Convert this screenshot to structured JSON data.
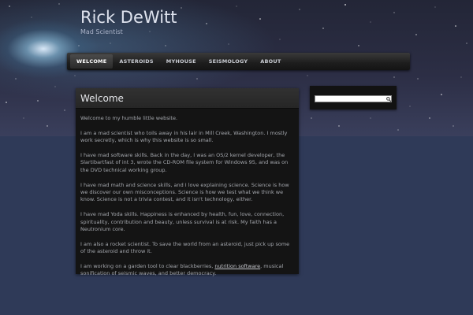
{
  "site": {
    "title": "Rick DeWitt",
    "tagline": "Mad Scientist"
  },
  "nav": {
    "items": [
      {
        "label": "WELCOME"
      },
      {
        "label": "ASTEROIDS"
      },
      {
        "label": "MYHOUSE"
      },
      {
        "label": "SEISMOLOGY"
      },
      {
        "label": "ABOUT"
      }
    ]
  },
  "search": {
    "value": "",
    "icon": "search-icon"
  },
  "main": {
    "title": "Welcome",
    "paragraphs": [
      "Welcome to my humble little website.",
      "I am a mad scientist who toils away in his lair in Mill Creek, Washington.  I mostly work secretly, which is why this website is so small.",
      "I have mad software skills.  Back in the day, I was an OS/2 kernel developer, the Slartibartfast of int 3, wrote the CD-ROM file system for Windows 95, and was on the DVD technical working group.",
      "I have mad math and science skills, and I love explaining science.  Science is how we discover our own misconceptions.  Science is how we test what we think we know.  Science is not a trivia contest, and it isn't technology, either.",
      "I have mad Yoda skills. Happiness is enhanced by health, fun, love, connection, spirituality, contribution and beauty, unless survival is at risk.  My faith has a Neutronium core.",
      "I am also a rocket scientist.  To save the world from an asteroid, just pick up some of the asteroid and throw it."
    ],
    "last_paragraph": {
      "before": "I am working on a garden tool to clear blackberries, ",
      "link": "nutrition software",
      "after": ", musical sonification of seismic waves, and better democracy."
    }
  },
  "colors": {
    "background": "#2f3a58",
    "panel": "#141414",
    "text": "#a4a7ad",
    "title": "#dfe3ee"
  }
}
